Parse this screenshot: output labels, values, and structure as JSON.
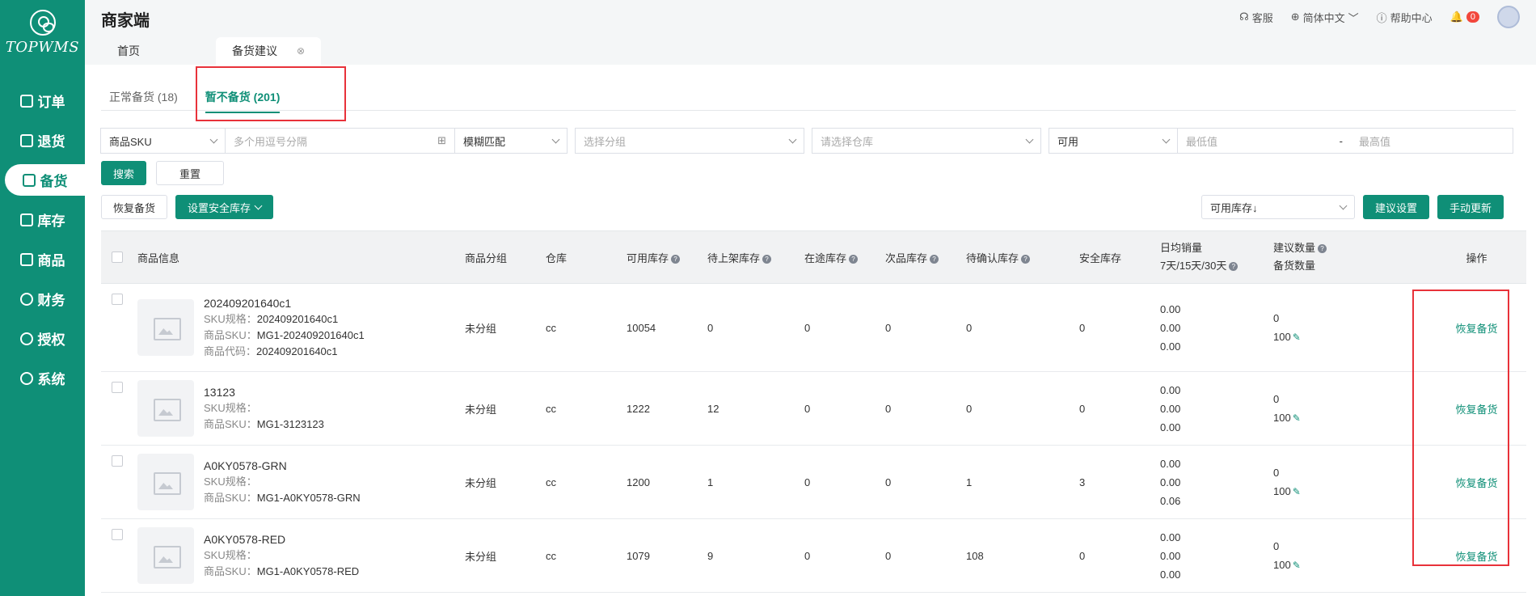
{
  "sidebar": {
    "logo_text": "TOPWMS",
    "items": [
      {
        "label": "订单",
        "icon": "order-icon"
      },
      {
        "label": "退货",
        "icon": "return-icon"
      },
      {
        "label": "备货",
        "icon": "stock-prep-icon"
      },
      {
        "label": "库存",
        "icon": "inventory-icon"
      },
      {
        "label": "商品",
        "icon": "product-icon"
      },
      {
        "label": "财务",
        "icon": "finance-icon"
      },
      {
        "label": "授权",
        "icon": "authorization-icon"
      },
      {
        "label": "系统",
        "icon": "system-icon"
      }
    ],
    "active_index": 2
  },
  "header": {
    "title": "商家端",
    "customer_service": "客服",
    "language": "简体中文",
    "help": "帮助中心",
    "notification_count": "0"
  },
  "page_tabs": [
    {
      "label": "首页"
    },
    {
      "label": "备货建议"
    }
  ],
  "subtabs": [
    {
      "label": "正常备货 (18)"
    },
    {
      "label": "暂不备货 (201)"
    }
  ],
  "filters": {
    "field_select": "商品SKU",
    "sku_placeholder": "多个用逗号分隔",
    "match_select": "模糊匹配",
    "group_placeholder": "选择分组",
    "warehouse_placeholder": "请选择仓库",
    "stock_type_select": "可用",
    "min_placeholder": "最低值",
    "range_sep": "-",
    "max_placeholder": "最高值"
  },
  "buttons": {
    "search": "搜索",
    "reset": "重置",
    "restore_stock": "恢复备货",
    "set_safety_stock": "设置安全库存",
    "sort_select": "可用库存↓",
    "suggest_settings": "建议设置",
    "manual_update": "手动更新"
  },
  "table": {
    "headers": {
      "product": "商品信息",
      "group": "商品分组",
      "warehouse": "仓库",
      "available": "可用库存",
      "pending_shelf": "待上架库存",
      "in_transit": "在途库存",
      "defective": "次品库存",
      "pending_confirm": "待确认库存",
      "safety": "安全库存",
      "daily_sales_1": "日均销量",
      "daily_sales_2": "7天/15天/30天",
      "suggest_1": "建议数量",
      "suggest_2": "备货数量",
      "action": "操作"
    },
    "labels": {
      "sku_spec": "SKU规格：",
      "product_sku": "商品SKU：",
      "product_code": "商品代码："
    },
    "rows": [
      {
        "name": "202409201640c1",
        "sku_spec": "202409201640c1",
        "product_sku": "MG1-202409201640c1",
        "product_code": "202409201640c1",
        "group": "未分组",
        "warehouse": "cc",
        "available": "10054",
        "pending_shelf": "0",
        "in_transit": "0",
        "defective": "0",
        "pending_confirm": "0",
        "safety": "0",
        "sales": [
          "0.00",
          "0.00",
          "0.00"
        ],
        "suggest": "0",
        "stock_qty": "100",
        "action": "恢复备货"
      },
      {
        "name": "13123",
        "sku_spec": "",
        "product_sku": "MG1-3123123",
        "group": "未分组",
        "warehouse": "cc",
        "available": "1222",
        "pending_shelf": "12",
        "in_transit": "0",
        "defective": "0",
        "pending_confirm": "0",
        "safety": "0",
        "sales": [
          "0.00",
          "0.00",
          "0.00"
        ],
        "suggest": "0",
        "stock_qty": "100",
        "action": "恢复备货"
      },
      {
        "name": "A0KY0578-GRN",
        "sku_spec": "",
        "product_sku": "MG1-A0KY0578-GRN",
        "group": "未分组",
        "warehouse": "cc",
        "available": "1200",
        "pending_shelf": "1",
        "in_transit": "0",
        "defective": "0",
        "pending_confirm": "1",
        "safety": "3",
        "sales": [
          "0.00",
          "0.00",
          "0.06"
        ],
        "suggest": "0",
        "stock_qty": "100",
        "action": "恢复备货"
      },
      {
        "name": "A0KY0578-RED",
        "sku_spec": "",
        "product_sku": "MG1-A0KY0578-RED",
        "group": "未分组",
        "warehouse": "cc",
        "available": "1079",
        "pending_shelf": "9",
        "in_transit": "0",
        "defective": "0",
        "pending_confirm": "108",
        "safety": "0",
        "sales": [
          "0.00",
          "0.00",
          "0.00"
        ],
        "suggest": "0",
        "stock_qty": "100",
        "action": "恢复备货"
      }
    ]
  },
  "colors": {
    "brand": "#0f8f77",
    "highlight": "#e8323a"
  }
}
